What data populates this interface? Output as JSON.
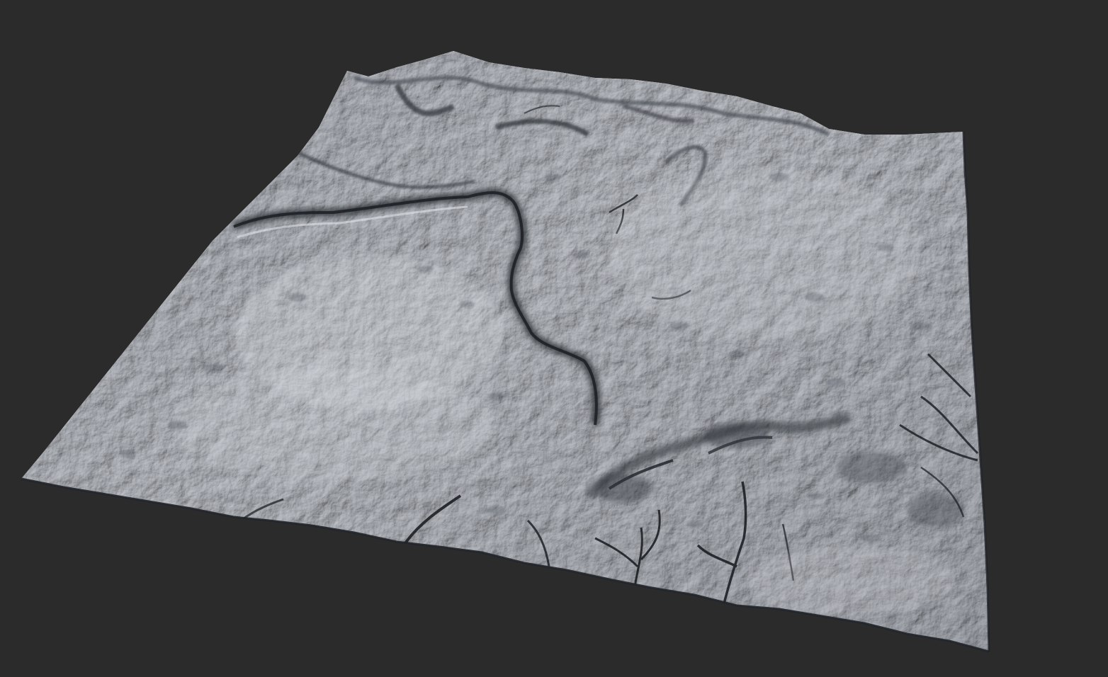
{
  "scene": {
    "subject": "terrain-heightfield",
    "background_color": "#2b2b2b",
    "terrain_light_color": "#c9cdd4",
    "terrain_mid_color": "#a7adb6",
    "terrain_shadow_color": "#3c4149",
    "terrain_deep_shadow_color": "#1f2227"
  }
}
